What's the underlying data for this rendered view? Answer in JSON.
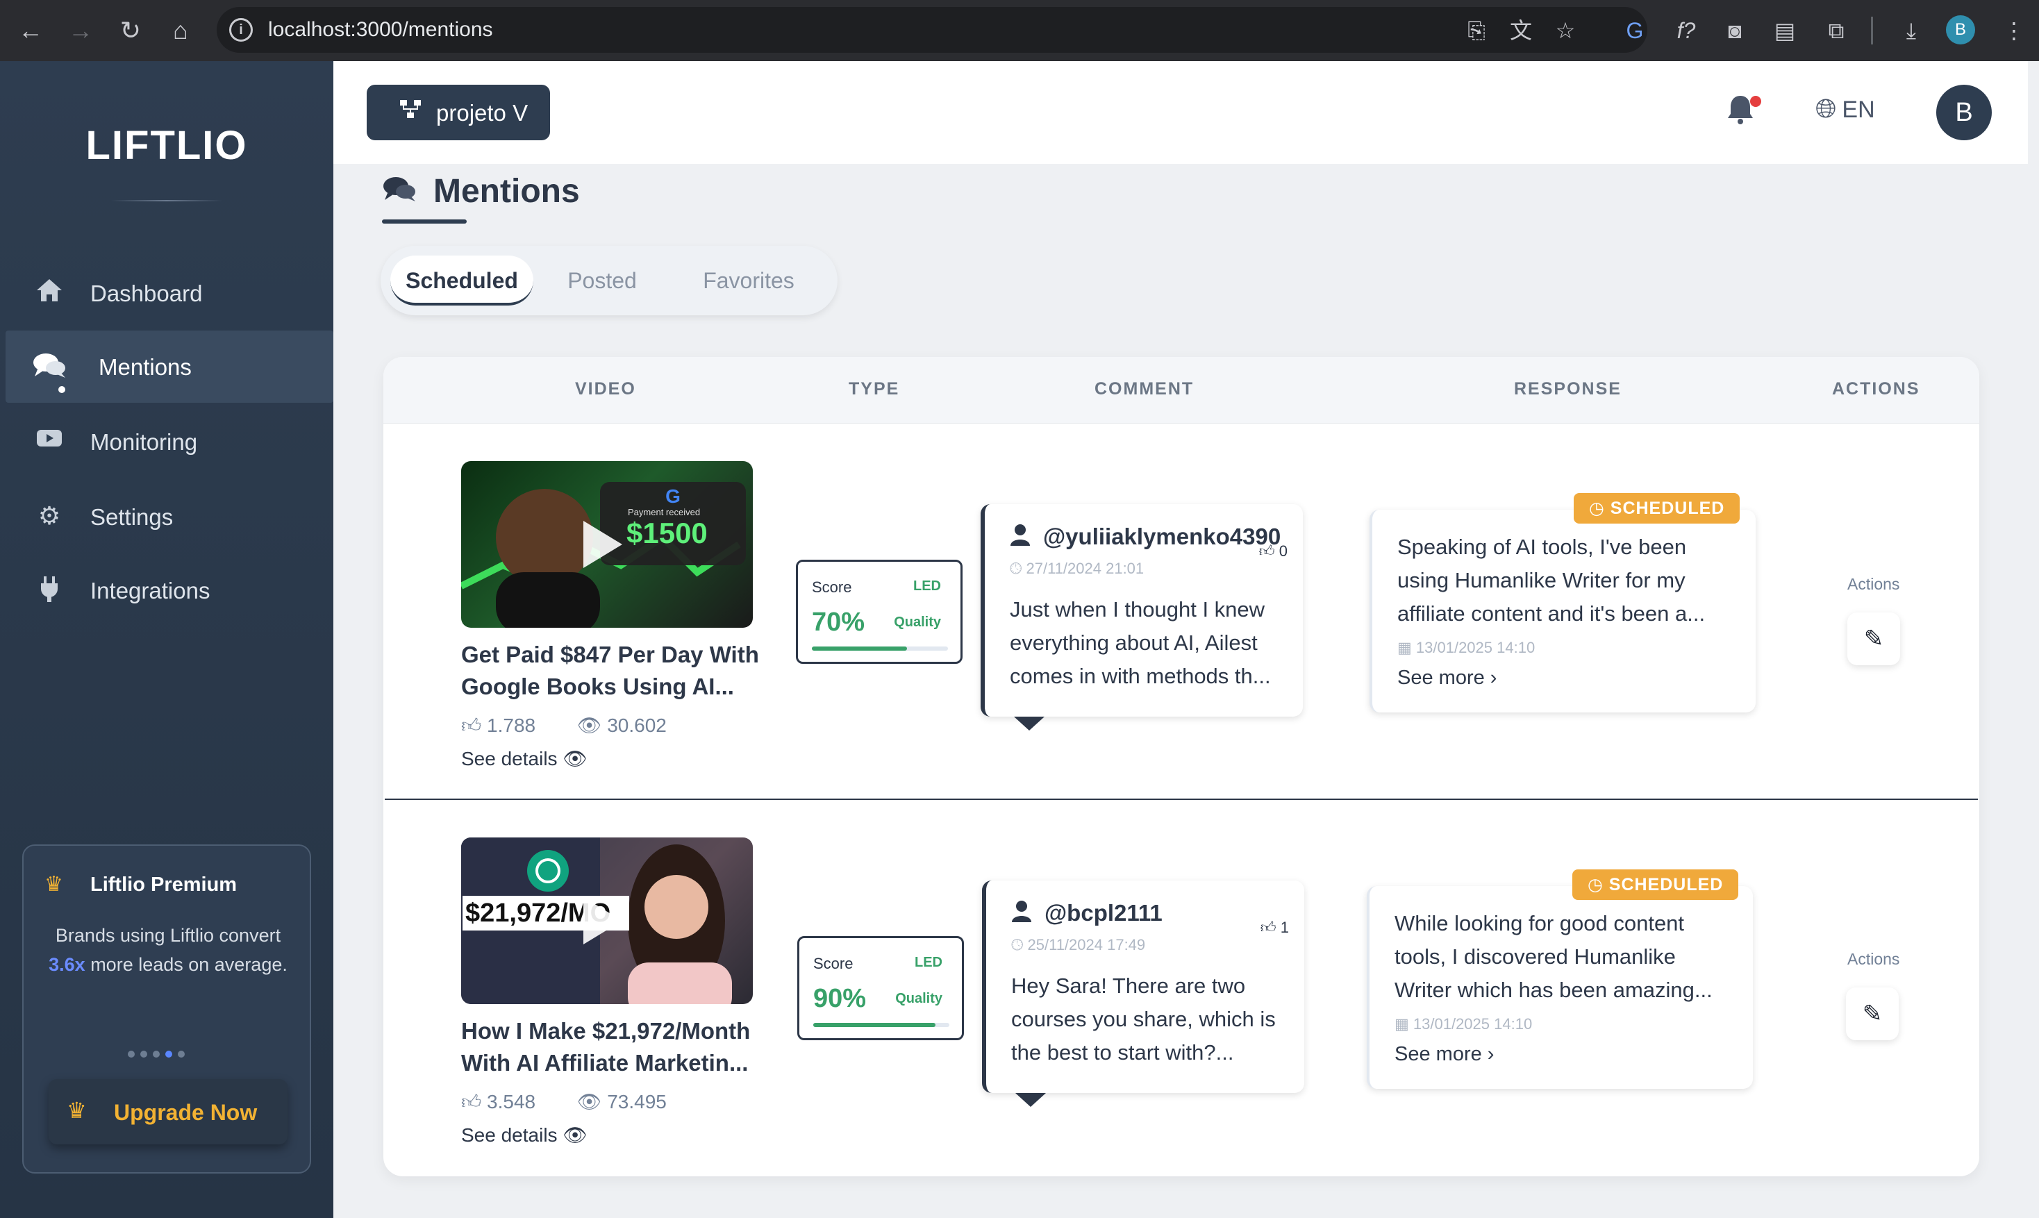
{
  "browser": {
    "url": "localhost:3000/mentions",
    "profile_initial": "B"
  },
  "sidebar": {
    "logo": "LIFTLIO",
    "items": [
      {
        "label": "Dashboard",
        "icon": "home-icon"
      },
      {
        "label": "Mentions",
        "icon": "comments-icon",
        "active": true
      },
      {
        "label": "Monitoring",
        "icon": "video-icon"
      },
      {
        "label": "Settings",
        "icon": "gear-icon"
      },
      {
        "label": "Integrations",
        "icon": "plug-icon"
      }
    ],
    "premium": {
      "title": "Liftlio Premium",
      "desc_before": "Brands using Liftlio convert ",
      "desc_highlight": "3.6x",
      "desc_after": " more leads on average.",
      "upgrade_label": "Upgrade Now"
    }
  },
  "header": {
    "project_label": "projeto V",
    "language": "EN",
    "user_initial": "B"
  },
  "page": {
    "title": "Mentions",
    "tabs": [
      "Scheduled",
      "Posted",
      "Favorites"
    ],
    "active_tab": "Scheduled"
  },
  "table": {
    "columns": [
      "VIDEO",
      "TYPE",
      "COMMENT",
      "RESPONSE",
      "ACTIONS"
    ],
    "rows": [
      {
        "video": {
          "title": "Get Paid $847 Per Day With Google Books Using AI...",
          "likes": "1.788",
          "views": "30.602",
          "details": "See details",
          "thumb_text": "$1500",
          "thumb_sub": "Payment received"
        },
        "type": {
          "score_label": "Score",
          "led": "LED",
          "score": "70%",
          "quality": "Quality",
          "score_fraction": 0.7
        },
        "comment": {
          "user": "@yuliiaklymenko4390",
          "likes": "0",
          "date": "27/11/2024 21:01",
          "text": "Just when I thought I knew everything about AI, Ailest comes in with methods th..."
        },
        "response": {
          "badge": "SCHEDULED",
          "text": "Speaking of AI tools, I've been using Humanlike Writer for my affiliate content and it's been a...",
          "date": "13/01/2025 14:10",
          "more": "See more"
        },
        "actions_label": "Actions"
      },
      {
        "video": {
          "title": "How I Make $21,972/Month With AI Affiliate Marketin...",
          "likes": "3.548",
          "views": "73.495",
          "details": "See details",
          "thumb_text": "$21,972/MO",
          "thumb_sub": ""
        },
        "type": {
          "score_label": "Score",
          "led": "LED",
          "score": "90%",
          "quality": "Quality",
          "score_fraction": 0.9
        },
        "comment": {
          "user": "@bcpl2111",
          "likes": "1",
          "date": "25/11/2024 17:49",
          "text": "Hey Sara! There are two courses you share, which is the best to start with?..."
        },
        "response": {
          "badge": "SCHEDULED",
          "text": "While looking for good content tools, I discovered Humanlike Writer which has been amazing...",
          "date": "13/01/2025 14:10",
          "more": "See more"
        },
        "actions_label": "Actions"
      }
    ]
  }
}
